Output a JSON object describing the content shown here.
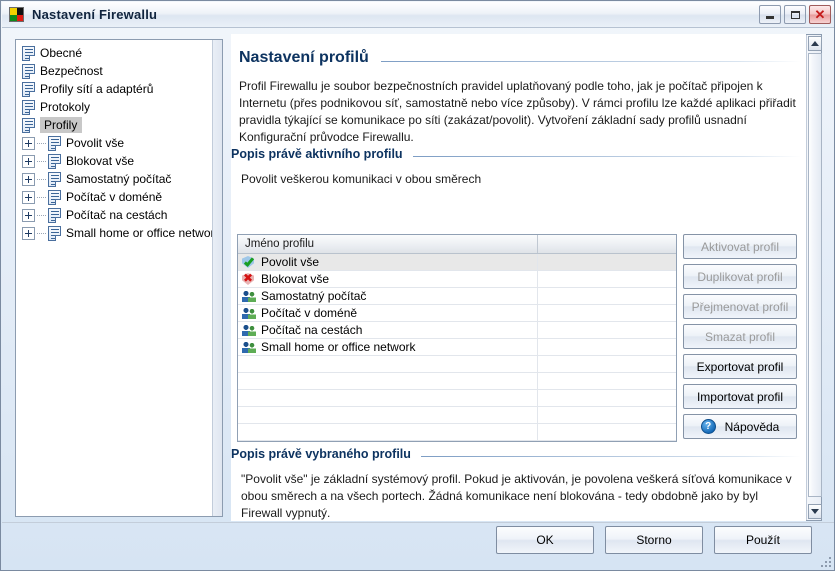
{
  "window": {
    "title": "Nastavení Firewallu",
    "icon": "avg-logo-icon",
    "controls": {
      "minimize": "minimize-button",
      "maximize": "maximize-button",
      "close": "✕"
    }
  },
  "tree": {
    "items": [
      {
        "label": "Obecné",
        "expandable": false,
        "selected": false
      },
      {
        "label": "Bezpečnost",
        "expandable": false,
        "selected": false
      },
      {
        "label": "Profily sítí a adaptérů",
        "expandable": false,
        "selected": false
      },
      {
        "label": "Protokoly",
        "expandable": false,
        "selected": false
      },
      {
        "label": "Profily",
        "expandable": false,
        "selected": true
      },
      {
        "label": "Povolit vše",
        "expandable": true,
        "selected": false
      },
      {
        "label": "Blokovat vše",
        "expandable": true,
        "selected": false
      },
      {
        "label": "Samostatný počítač",
        "expandable": true,
        "selected": false
      },
      {
        "label": "Počítač v doméně",
        "expandable": true,
        "selected": false
      },
      {
        "label": "Počítač na cestách",
        "expandable": true,
        "selected": false
      },
      {
        "label": "Small home or office network",
        "expandable": true,
        "selected": false
      }
    ]
  },
  "content": {
    "heading": "Nastavení profilů",
    "intro": "Profil Firewallu je soubor bezpečnostních pravidel uplatňovaný podle toho, jak je počítač připojen k Internetu (přes podnikovou síť, samostatně nebo více způsoby). V rámci profilu lze každé aplikaci přiřadit pravidla týkající se komunikace po síti (zakázat/povolit). Vytvoření základní sady profilů usnadní Konfigurační průvodce Firewallu.",
    "active_section_title": "Popis právě aktivního profilu",
    "active_section_text": "Povolit veškerou komunikaci v obou směrech",
    "selected_section_title": "Popis právě vybraného profilu",
    "selected_section_text": "\"Povolit vše\" je základní systémový profil. Pokud je aktivován, je povolena veškerá síťová komunikace v obou směrech a na všech portech. Žádná komunikace není blokována - tedy obdobně jako by byl Firewall vypnutý."
  },
  "table": {
    "columns": [
      "Jméno profilu",
      ""
    ],
    "rows": [
      {
        "name": "Povolit vše",
        "icon": "allow-shield-icon",
        "selected": true
      },
      {
        "name": "Blokovat vše",
        "icon": "block-shield-icon",
        "selected": false
      },
      {
        "name": "Samostatný počítač",
        "icon": "users-icon",
        "selected": false
      },
      {
        "name": "Počítač v doméně",
        "icon": "users-icon",
        "selected": false
      },
      {
        "name": "Počítač na cestách",
        "icon": "users-icon",
        "selected": false
      },
      {
        "name": "Small home or office network",
        "icon": "users-icon",
        "selected": false
      }
    ],
    "empty_rows": 5
  },
  "side_buttons": [
    {
      "label": "Aktivovat profil",
      "disabled": true,
      "icon": null
    },
    {
      "label": "Duplikovat profil",
      "disabled": true,
      "icon": null
    },
    {
      "label": "Přejmenovat profil",
      "disabled": true,
      "icon": null
    },
    {
      "label": "Smazat profil",
      "disabled": true,
      "icon": null
    },
    {
      "label": "Exportovat profil",
      "disabled": false,
      "icon": null
    },
    {
      "label": "Importovat profil",
      "disabled": false,
      "icon": null
    },
    {
      "label": "Nápověda",
      "disabled": false,
      "icon": "help-question-icon",
      "icon_glyph": "?"
    }
  ],
  "dialog_buttons": [
    {
      "label": "OK"
    },
    {
      "label": "Storno"
    },
    {
      "label": "Použít"
    }
  ],
  "colors": {
    "heading": "#0d3360",
    "window_bg": "#d6e4f3",
    "selection": "#e8e8e8",
    "close_red": "#c41a1a"
  }
}
